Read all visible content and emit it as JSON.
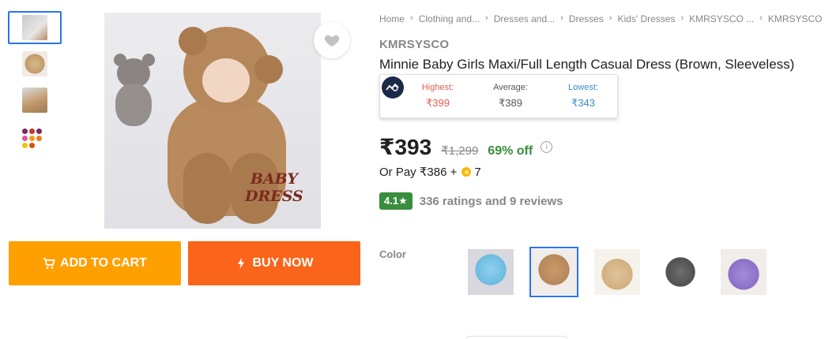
{
  "breadcrumb": [
    "Home",
    "Clothing and...",
    "Dresses and...",
    "Dresses",
    "Kids' Dresses",
    "KMRSYSCO ...",
    "KMRSYSCO Minnie"
  ],
  "product": {
    "brand": "KMRSYSCO",
    "title": "Minnie Baby Girls Maxi/Full Length Casual Dress  (Brown, Sleeveless)",
    "image_text_line1": "BABY",
    "image_text_line2": "DRESS"
  },
  "price_tracker": {
    "highest_label": "Highest:",
    "highest_value": "₹399",
    "average_label": "Average:",
    "average_value": "₹389",
    "lowest_label": "Lowest:",
    "lowest_value": "₹343"
  },
  "pricing": {
    "price": "₹393",
    "mrp": "₹1,299",
    "discount": "69% off",
    "info_symbol": "i",
    "or_pay": "Or Pay ₹386 +",
    "coins": "7"
  },
  "rating": {
    "score": "4.1★",
    "summary": "336 ratings and 9 reviews"
  },
  "color": {
    "label": "Color",
    "options": [
      "light-blue-wrap",
      "brown-wrap",
      "beige-wrap",
      "grey-polka-wrap",
      "purple-wrap"
    ],
    "selected_index": 1
  },
  "actions": {
    "add_to_cart": "ADD TO CART",
    "buy_now": "BUY NOW"
  },
  "icons": {
    "wishlist": "heart-icon",
    "cart": "cart-icon",
    "buy": "lightning-icon",
    "tracker": "price-tracker-logo-icon",
    "breadcrumb_sep": "chevron-right-icon"
  },
  "colors": {
    "accent_blue": "#2874f0",
    "cart_orange": "#ff9f00",
    "buy_orange": "#fb641b",
    "discount_green": "#388e3c",
    "highest_red": "#e35f52",
    "lowest_blue": "#3a8fc4"
  }
}
